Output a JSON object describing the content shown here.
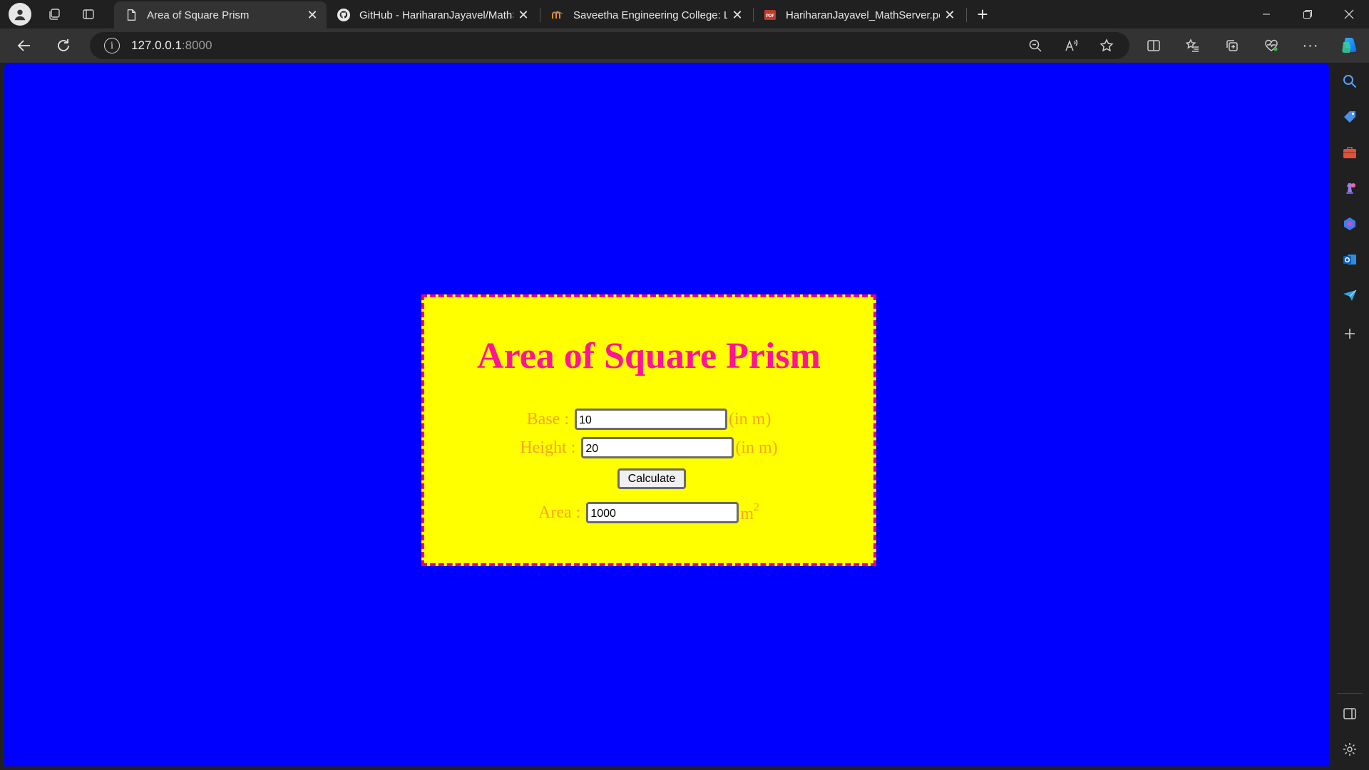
{
  "browser": {
    "tabs": [
      {
        "title": "Area of Square Prism",
        "icon": "page-icon",
        "active": true
      },
      {
        "title": "GitHub - HariharanJayavel/MathS",
        "icon": "github-icon",
        "active": false
      },
      {
        "title": "Saveetha Engineering College: Lo",
        "icon": "moodle-icon",
        "active": false
      },
      {
        "title": "HariharanJayavel_MathServer.pdf",
        "icon": "pdf-icon",
        "active": false
      }
    ],
    "address": {
      "host": "127.0.0.1",
      "port": ":8000"
    }
  },
  "page": {
    "title": "Area of Square Prism",
    "base": {
      "label": "Base :",
      "value": "10",
      "unit": "(in m)"
    },
    "height": {
      "label": "Height :",
      "value": "20",
      "unit": "(in m)"
    },
    "calculate_label": "Calculate",
    "area": {
      "label": "Area :",
      "value": "1000",
      "unit": "m",
      "unit_sup": "2"
    },
    "colors": {
      "background": "#0000ff",
      "card": "#ffff00",
      "border": "#e8007a",
      "title": "#ff1493",
      "label": "#f5a623"
    }
  }
}
